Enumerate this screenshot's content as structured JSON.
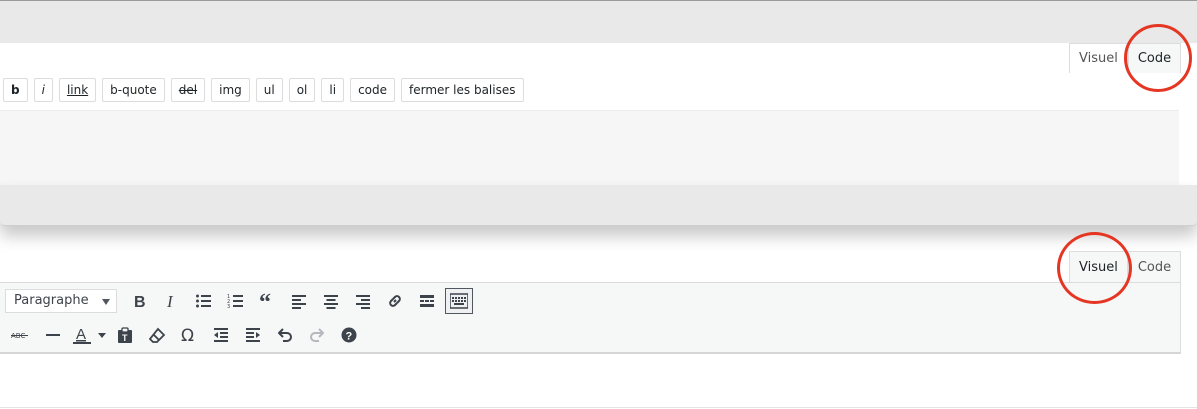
{
  "code_editor": {
    "tabs": [
      "Visuel",
      "Code"
    ],
    "active_tab": "Code",
    "quicktags": [
      "b",
      "i",
      "link",
      "b-quote",
      "del",
      "img",
      "ul",
      "ol",
      "li",
      "code",
      "fermer les balises"
    ]
  },
  "visual_editor": {
    "tabs": [
      "Visuel",
      "Code"
    ],
    "active_tab": "Visuel",
    "format_select": "Paragraphe",
    "toolbar_row1_icons": [
      "bold-icon",
      "italic-icon",
      "bullet-list-icon",
      "numbered-list-icon",
      "blockquote-icon",
      "align-left-icon",
      "align-center-icon",
      "align-right-icon",
      "link-icon",
      "read-more-icon",
      "toolbar-toggle-icon"
    ],
    "toolbar_row2_icons": [
      "strikethrough-icon",
      "horizontal-line-icon",
      "text-color-icon",
      "paste-text-icon",
      "clear-formatting-icon",
      "special-character-icon",
      "outdent-icon",
      "indent-icon",
      "undo-icon",
      "redo-icon",
      "help-icon"
    ]
  },
  "colors": {
    "highlight_ring": "#e53623",
    "toolbar_bg": "#f6f7f7",
    "panel_bg": "#e9e9e9"
  }
}
